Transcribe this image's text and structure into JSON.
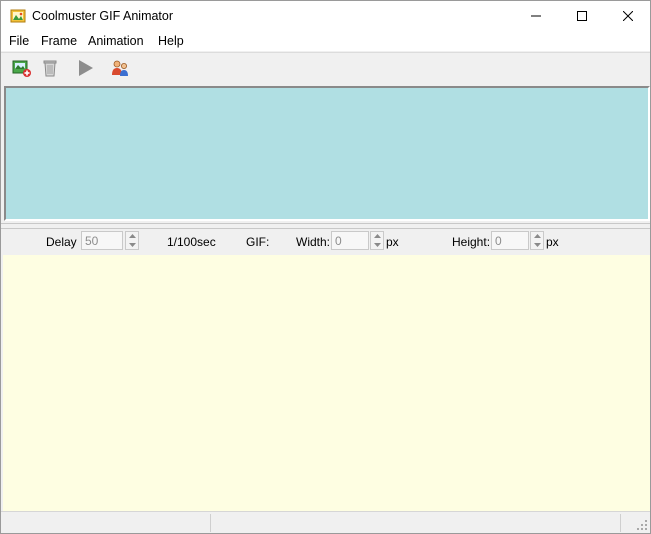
{
  "window": {
    "title": "Coolmuster GIF Animator"
  },
  "menu": {
    "items": [
      {
        "label": "File"
      },
      {
        "label": "Frame"
      },
      {
        "label": "Animation"
      },
      {
        "label": "Help"
      }
    ]
  },
  "toolbar": {
    "icons": [
      "add-frames-icon",
      "recycle-bin-icon",
      "play-icon",
      "users-icon"
    ]
  },
  "settings": {
    "delay_label": "Delay :",
    "delay_value": "50",
    "delay_unit": "1/100sec",
    "gif_label": "GIF:",
    "width_label": "Width:",
    "width_value": "0",
    "width_unit": "px",
    "height_label": "Height:",
    "height_value": "0",
    "height_unit": "px"
  },
  "colors": {
    "frames_panel_bg": "#b0dfe3",
    "preview_bg": "#fefee2"
  }
}
